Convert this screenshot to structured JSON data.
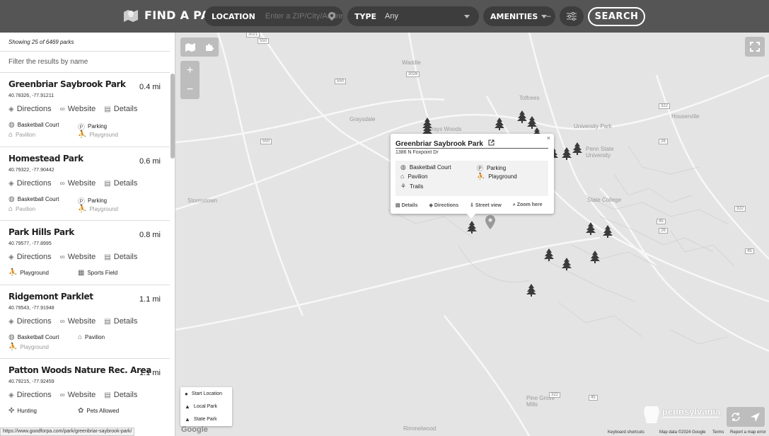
{
  "header": {
    "logo_text": "FIND A PARK",
    "location_label": "LOCATION",
    "location_placeholder": "Enter a ZIP/City/Address",
    "type_label": "TYPE",
    "type_value": "Any",
    "amenities_label": "AMENITIES",
    "amenities_value": "–",
    "search_label": "SEARCH"
  },
  "sidebar": {
    "showing": "Showing 25 of 6469 parks",
    "filter_placeholder": "Filter the results by name",
    "action_directions": "Directions",
    "action_website": "Website",
    "action_details": "Details",
    "parks": [
      {
        "name": "Greenbriar Saybrook Park",
        "coords": "40.78326, -77.91211",
        "distance": "0.4 mi",
        "amenities": [
          [
            "basketball-icon",
            "Basketball Court"
          ],
          [
            "parking-icon",
            "Parking"
          ],
          [
            "pavilion-icon",
            "Pavilion"
          ],
          [
            "playground-icon",
            "Playground"
          ]
        ]
      },
      {
        "name": "Homestead Park",
        "coords": "40.79322, -77.90442",
        "distance": "0.6 mi",
        "amenities": [
          [
            "basketball-icon",
            "Basketball Court"
          ],
          [
            "parking-icon",
            "Parking"
          ],
          [
            "pavilion-icon",
            "Pavilion"
          ],
          [
            "playground-icon",
            "Playground"
          ]
        ]
      },
      {
        "name": "Park Hills Park",
        "coords": "40.79577, -77.8995",
        "distance": "0.8 mi",
        "amenities": [
          [
            "playground-icon",
            "Playground"
          ],
          [
            "sports-field-icon",
            "Sports Field"
          ]
        ]
      },
      {
        "name": "Ridgemont Parklet",
        "coords": "40.79543, -77.91948",
        "distance": "1.1 mi",
        "amenities": [
          [
            "basketball-icon",
            "Basketball Court"
          ],
          [
            "pavilion-icon",
            "Pavilion"
          ],
          [
            "playground-icon",
            "Playground"
          ]
        ]
      },
      {
        "name": "Patton Woods Nature Rec. Area",
        "coords": "40.79215, -77.92459",
        "distance": "1.1 mi",
        "amenities": [
          [
            "hunting-icon",
            "Hunting"
          ],
          [
            "pets-icon",
            "Pets Allowed"
          ]
        ]
      }
    ],
    "status_url": "https://www.goodforpa.com/park/greenbriar-saybrook-park/"
  },
  "map": {
    "places": [
      "Waddle",
      "Toftrees",
      "Grays Woods",
      "Graysdale",
      "Stormstown",
      "University Park",
      "Penn State University",
      "State College",
      "Houserville",
      "Pine Grove Mills",
      "Rimmelwood"
    ],
    "shields": [
      "3021",
      "550",
      "3028",
      "550",
      "550",
      "322",
      "26",
      "322",
      "45",
      "26",
      "45",
      "322",
      "45"
    ],
    "popup": {
      "title": "Greenbriar Saybrook Park",
      "address": "1386 N Foxpoint Dr",
      "close": "×",
      "amenities": [
        [
          "basketball-icon",
          "Basketball Court"
        ],
        [
          "parking-icon",
          "Parking"
        ],
        [
          "pavilion-icon",
          "Pavilion"
        ],
        [
          "playground-icon",
          "Playground"
        ],
        [
          "trails-icon",
          "Trails"
        ]
      ],
      "links": [
        "Details",
        "Directions",
        "Street view",
        "Zoom here"
      ]
    },
    "legend": [
      "Start Location",
      "Local Park",
      "State Park"
    ],
    "footer": {
      "google": "Google",
      "shortcuts": "Keyboard shortcuts",
      "mapdata": "Map data ©2024 Google",
      "terms": "Terms",
      "report": "Report a map error",
      "pa_logo": "pennsylvania"
    },
    "zoom_in": "+",
    "zoom_out": "−"
  },
  "colors": {
    "header_bg": "#555555",
    "pill_bg": "#3d3d3d",
    "tree": "#3a3a3a",
    "map_bg": "#e4e4e4"
  }
}
